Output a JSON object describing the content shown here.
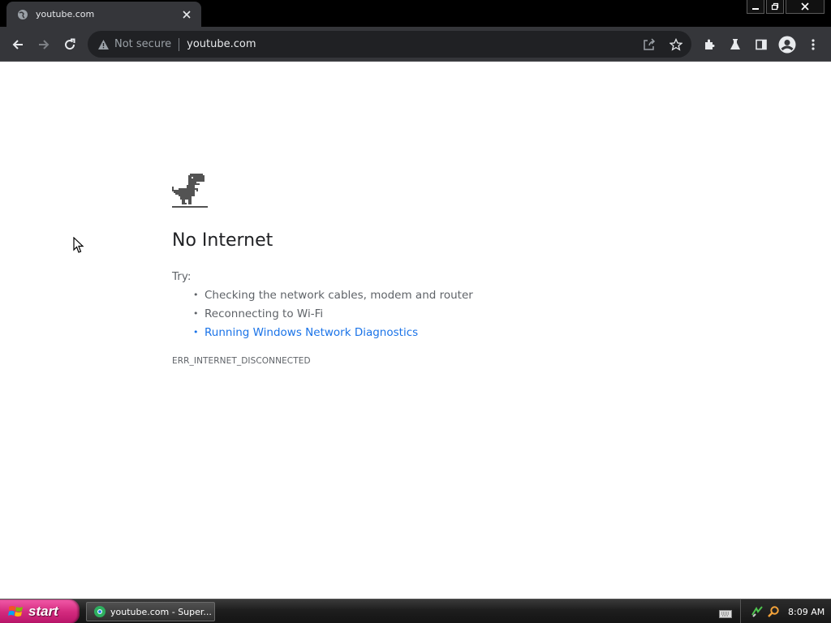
{
  "browser": {
    "tab": {
      "title": "youtube.com",
      "favicon": "globe-icon"
    },
    "window_controls": [
      "minimize-icon",
      "restore-icon",
      "close-icon"
    ],
    "toolbar": {
      "back": "back-arrow-icon",
      "forward": "forward-arrow-icon",
      "reload": "reload-icon",
      "security_label": "Not secure",
      "url": "youtube.com",
      "right_icons": [
        "share-icon",
        "bookmark-star-icon",
        "extensions-icon",
        "labs-flask-icon",
        "side-panel-icon",
        "profile-avatar-icon",
        "menu-dots-icon"
      ]
    }
  },
  "error_page": {
    "title": "No Internet",
    "try_label": "Try:",
    "suggestions": [
      "Checking the network cables, modem and router",
      "Reconnecting to Wi-Fi",
      "Running Windows Network Diagnostics"
    ],
    "error_code": "ERR_INTERNET_DISCONNECTED"
  },
  "taskbar": {
    "start_label": "start",
    "task": "youtube.com - Super...",
    "clock": "8:09 AM"
  },
  "colors": {
    "link": "#1a73e8",
    "toolbar": "#35363a",
    "omnibox": "#202124",
    "start": "#d42b7f"
  }
}
